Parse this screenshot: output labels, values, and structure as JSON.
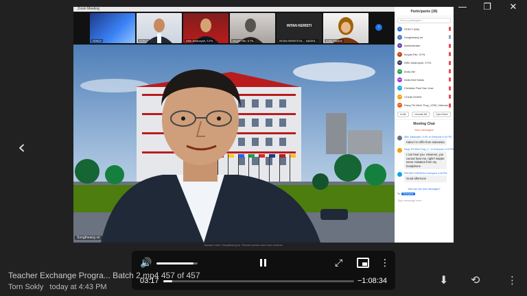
{
  "window": {
    "meeting_title": "Zoom Meeting",
    "minimize_icon": "minimize-icon",
    "maximize_icon": "maximize-icon",
    "close_icon": "close-icon"
  },
  "gallery": {
    "tiles": [
      {
        "name": "SOKLY"
      },
      {
        "name": "SOKLY"
      },
      {
        "name": "Affin Julianzyah, S.Pd."
      },
      {
        "name": "Isnyati Fitri, S.Pd."
      },
      {
        "name": "INTAN KERISTIYA ... NASIHI...",
        "big": "INTAN KERISTI"
      },
      {
        "name": "Sofia Susanti"
      }
    ]
  },
  "main_video": {
    "speaker_name": "Songtheang sri"
  },
  "participants": {
    "header": "Participants (28)",
    "search_placeholder": "Find a participant",
    "list": [
      {
        "initials": "S",
        "name": "SOKLY (Me)",
        "color": "#2f6fd6",
        "muted": true
      },
      {
        "initials": "S",
        "name": "Songtheang sri",
        "color": "#4a79b8",
        "muted": false
      },
      {
        "initials": "A",
        "name": "Administrator",
        "color": "#6b46c1",
        "muted": true
      },
      {
        "initials": "IF",
        "name": "Isnyati Fitri, S.Pd.",
        "color": "#c2410c",
        "muted": true
      },
      {
        "initials": "AJ",
        "name": "Affin Julianzyah, S.Pd.",
        "color": "#334155",
        "muted": true
      },
      {
        "initials": "AA",
        "name": "Andy Ate",
        "color": "#16a34a",
        "muted": true
      },
      {
        "initials": "AM",
        "name": "Anita Moil Nasto",
        "color": "#9333ea",
        "muted": true
      },
      {
        "initials": "CS",
        "name": "Christian Paul San Jose",
        "color": "#0ea5e9",
        "muted": true
      },
      {
        "initials": "CS",
        "name": "CHUM SOKRI",
        "color": "#f59e0b",
        "muted": true
      },
      {
        "initials": "DT",
        "name": "Dang Thi Minh Thuy_VOM_Vietnam",
        "color": "#ea580c",
        "muted": true
      }
    ],
    "buttons": {
      "invite": "Invite",
      "unmute": "Unmute Me",
      "open_more": "Open More"
    }
  },
  "chat": {
    "header": "Meeting Chat",
    "new_messages": "New messages",
    "messages": [
      {
        "from": "Affin Julianzyah, S.Pd. to Everyone 4:14 PM",
        "text": "Haloo I'm Affin from Indonesia",
        "color": "#64748b"
      },
      {
        "from": "Dang Thi Minh Thuy_V... to Everyone 4:15 PM",
        "text": "I can hear you. However, you cannot hear me, right? Maybe some mistakes from my headphone.",
        "color": "#f59e0b"
      },
      {
        "from": "NGUON CHENDA to Everyone 4:16 PM",
        "text": "Good afternoon",
        "color": "#0ea5e9"
      }
    ],
    "who_can_see": "Who can see your messages?",
    "to_label": "To:",
    "to_value": "Everyone",
    "type_placeholder": "Type message here..."
  },
  "caption": "Speaker view: Songtheang sri. Shared screen and more controls",
  "player": {
    "current_time": "03:17",
    "remaining_time": "−1:08:34",
    "volume_level": 0.9,
    "progress": 0.046
  },
  "file": {
    "title": "Teacher Exchange Progra... Batch 2.mp4",
    "index": "457 of 457",
    "owner": "Torn Sokly",
    "time": "today at 4:43 PM"
  }
}
